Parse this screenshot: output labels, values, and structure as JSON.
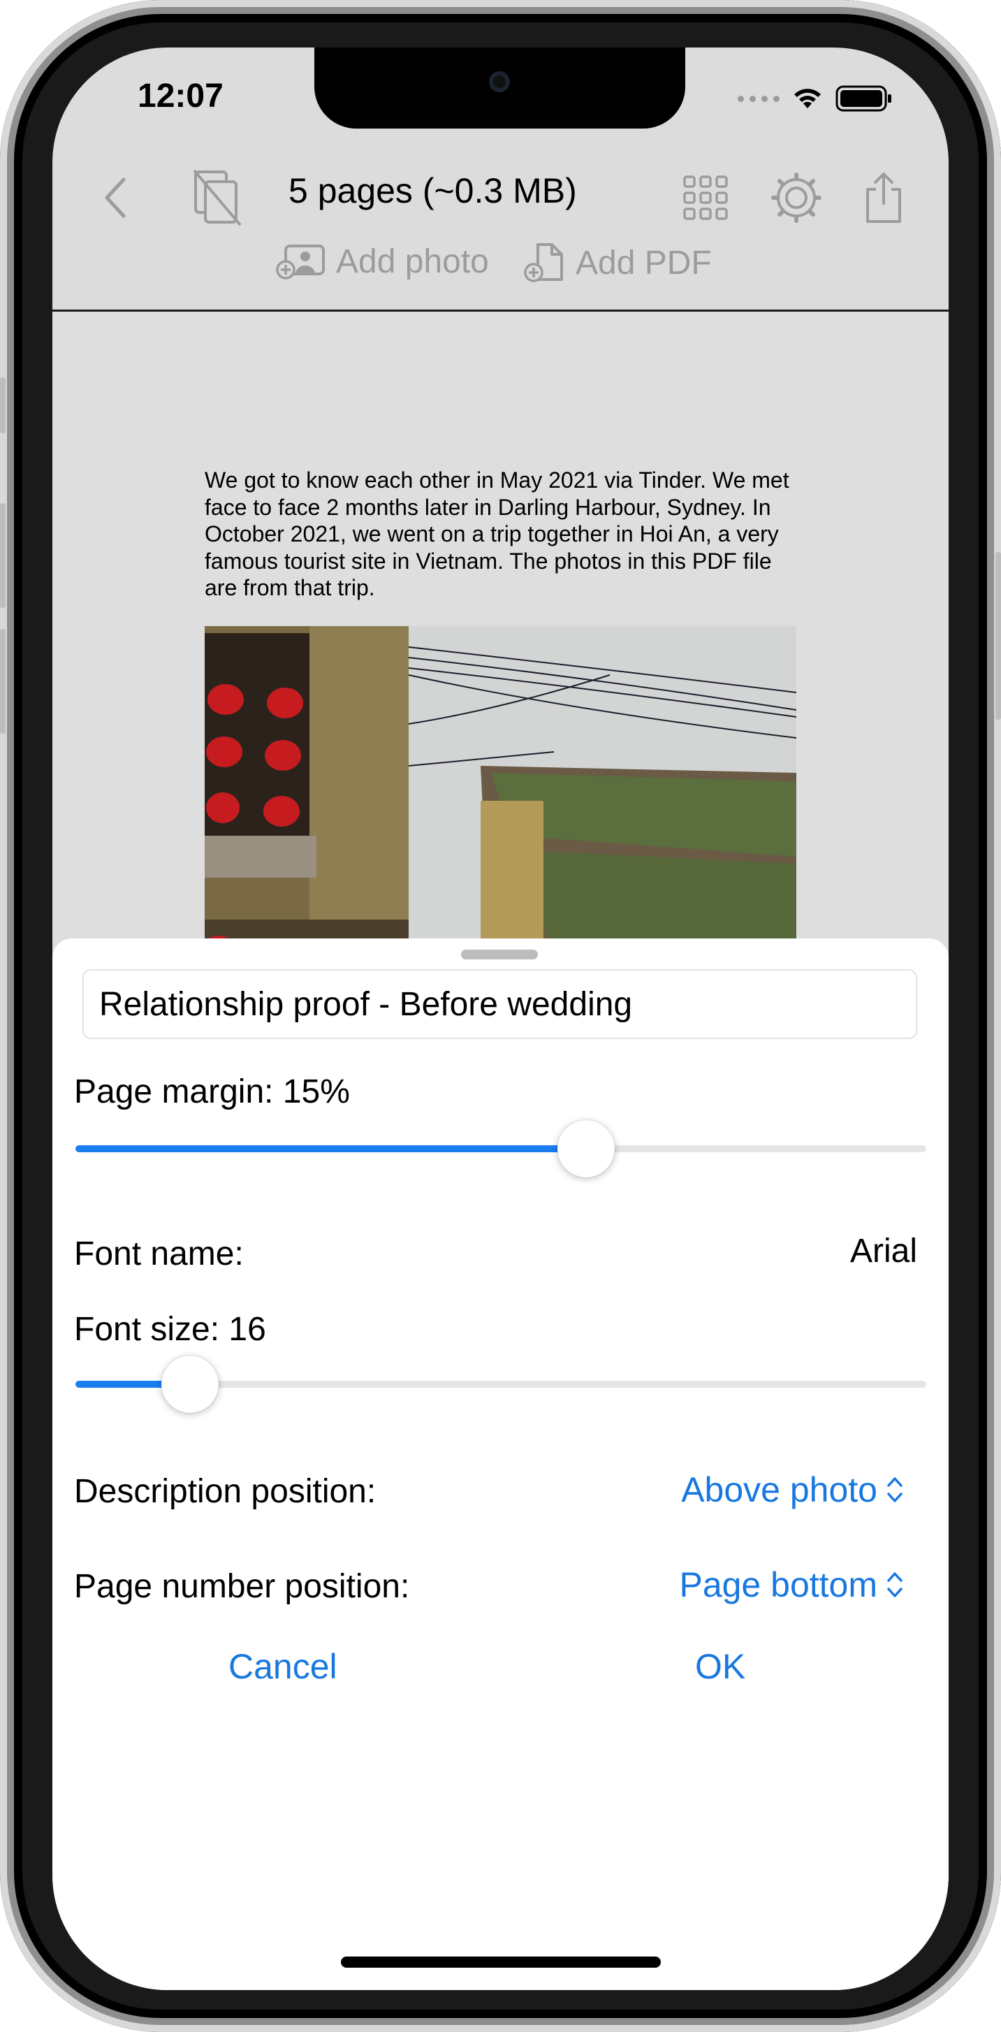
{
  "status": {
    "time": "12:07"
  },
  "toolbar": {
    "title": "5 pages (~0.3 MB)"
  },
  "add": {
    "photo": "Add photo",
    "pdf": "Add PDF"
  },
  "document": {
    "description": "We got to know each other in May 2021 via Tinder. We met face to face 2 months later in Darling Harbour, Sydney. In October 2021, we went on a trip together in Hoi An, a very famous tourist site in Vietnam. The photos in this PDF file are from that trip."
  },
  "sheet": {
    "title_value": "Relationship proof - Before wedding",
    "page_margin_label": "Page margin: 15%",
    "page_margin_fraction": 0.6,
    "font_name_label": "Font name:",
    "font_name_value": "Arial",
    "font_size_label": "Font size: 16",
    "font_size_fraction": 0.135,
    "description_position_label": "Description position:",
    "description_position_value": "Above photo",
    "page_number_position_label": "Page number position:",
    "page_number_position_value": "Page bottom",
    "cancel": "Cancel",
    "ok": "OK"
  },
  "colors": {
    "accent": "#1878e0",
    "slider": "#1a7ef0",
    "icon_gray": "#9c9c9c"
  },
  "icons": [
    "back-chevron-icon",
    "pages-icon",
    "grid-icon",
    "gear-icon",
    "share-icon",
    "add-photo-icon",
    "add-pdf-icon",
    "up-down-chevron-icon"
  ]
}
